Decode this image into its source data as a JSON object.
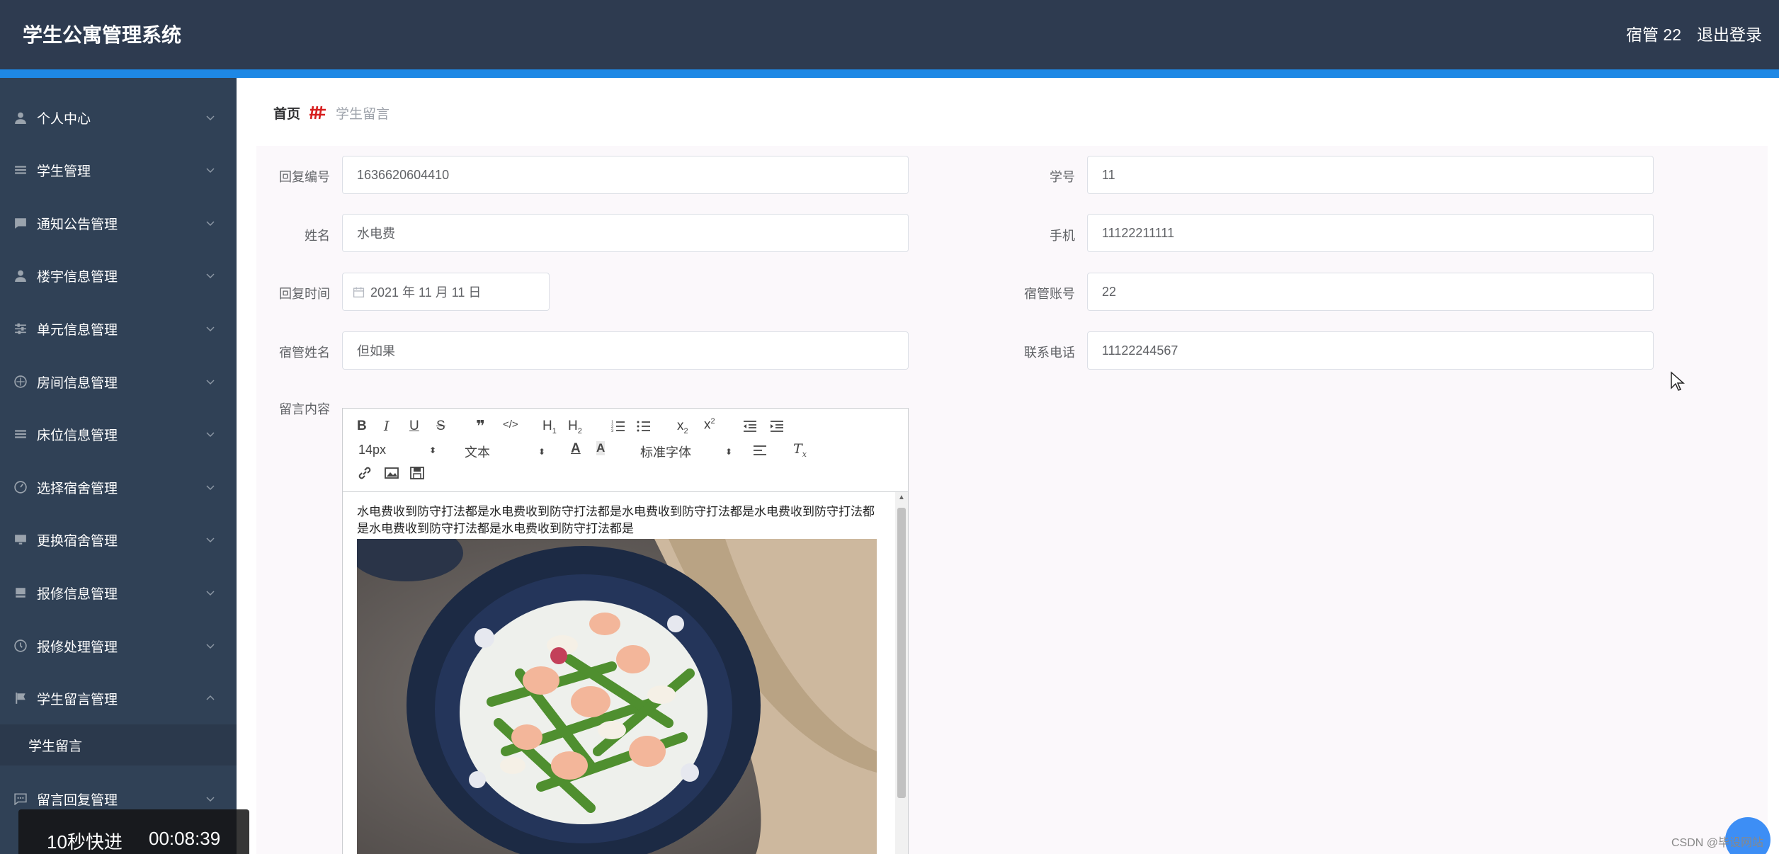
{
  "app": {
    "title": "学生公寓管理系统",
    "user": "宿管 22",
    "logout": "退出登录"
  },
  "sidebar": {
    "items": [
      {
        "label": "个人中心",
        "icon": "user-icon"
      },
      {
        "label": "学生管理",
        "icon": "list-icon"
      },
      {
        "label": "通知公告管理",
        "icon": "message-icon"
      },
      {
        "label": "楼宇信息管理",
        "icon": "user-icon"
      },
      {
        "label": "单元信息管理",
        "icon": "sliders-icon"
      },
      {
        "label": "房间信息管理",
        "icon": "compass-icon"
      },
      {
        "label": "床位信息管理",
        "icon": "list-icon"
      },
      {
        "label": "选择宿舍管理",
        "icon": "gauge-icon"
      },
      {
        "label": "更换宿舍管理",
        "icon": "monitor-icon"
      },
      {
        "label": "报修信息管理",
        "icon": "notebook-icon"
      },
      {
        "label": "报修处理管理",
        "icon": "clock-icon"
      },
      {
        "label": "学生留言管理",
        "icon": "flag-icon",
        "expanded": true
      },
      {
        "label": "留言回复管理",
        "icon": "chat-icon"
      }
    ],
    "submenu": {
      "label": "学生留言"
    }
  },
  "breadcrumb": {
    "home": "首页",
    "current": "学生留言"
  },
  "form": {
    "reply_no": {
      "label": "回复编号",
      "value": "1636620604410"
    },
    "student_no": {
      "label": "学号",
      "value": "11"
    },
    "name": {
      "label": "姓名",
      "value": "水电费"
    },
    "phone": {
      "label": "手机",
      "value": "11122211111"
    },
    "reply_time": {
      "label": "回复时间",
      "value": "2021 年 11 月 11 日"
    },
    "manager_account": {
      "label": "宿管账号",
      "value": "22"
    },
    "manager_name": {
      "label": "宿管姓名",
      "value": "但如果"
    },
    "contact_phone": {
      "label": "联系电话",
      "value": "11122244567"
    },
    "content": {
      "label": "留言内容"
    }
  },
  "editor": {
    "font_size": "14px",
    "block_type": "文本",
    "font_family": "标准字体",
    "text": "水电费收到防守打法都是水电费收到防守打法都是水电费收到防守打法都是水电费收到防守打法都是水电费收到防守打法都是水电费收到防守打法都是"
  },
  "video": {
    "fast_forward": "10秒快进",
    "time": "00:08:39"
  },
  "watermark": "CSDN @毕设网站",
  "colors": {
    "header": "#2e3b50",
    "accent": "#1e88e5",
    "sidebar": "#304156",
    "panel": "#fbf8fb"
  }
}
